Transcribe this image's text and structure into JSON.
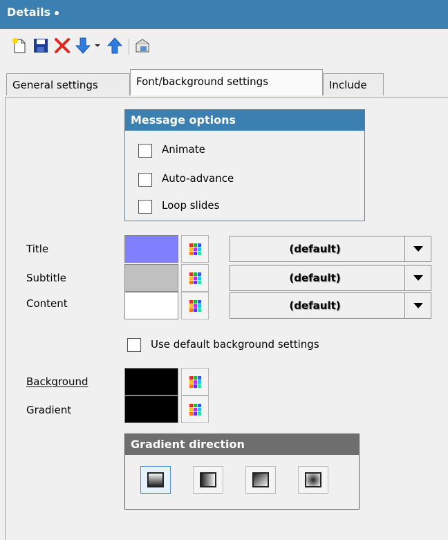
{
  "header": {
    "title": "Details"
  },
  "toolbar": {
    "icons": [
      "new-icon",
      "save-icon",
      "delete-icon",
      "move-down-icon",
      "dropdown-arrow-icon",
      "move-up-icon",
      "export-icon"
    ]
  },
  "tabs": [
    {
      "label": "General settings",
      "active": false
    },
    {
      "label": "Font/background settings",
      "active": true
    },
    {
      "label": "Include",
      "active": false
    }
  ],
  "message_options": {
    "title": "Message options",
    "items": [
      {
        "label": "Animate",
        "checked": false
      },
      {
        "label": "Auto-advance",
        "checked": false
      },
      {
        "label": "Loop slides",
        "checked": false
      }
    ]
  },
  "fonts": {
    "rows": [
      {
        "label": "Title",
        "color": "#8080ff",
        "font": "(default)"
      },
      {
        "label": "Subtitle",
        "color": "#c0c0c0",
        "font": "(default)"
      },
      {
        "label": "Content",
        "color": "#ffffff",
        "font": "(default)"
      }
    ]
  },
  "background": {
    "use_default_label": "Use default background settings",
    "use_default_checked": false,
    "background_label": "Background",
    "background_color": "#000000",
    "gradient_label": "Gradient",
    "gradient_color": "#000000"
  },
  "gradient_direction": {
    "title": "Gradient direction",
    "selected_index": 0
  },
  "colors": {
    "header_blue": "#3c7fb1",
    "group_header_blue": "#3c7fb1",
    "group_header_gray": "#6e6e6e"
  }
}
